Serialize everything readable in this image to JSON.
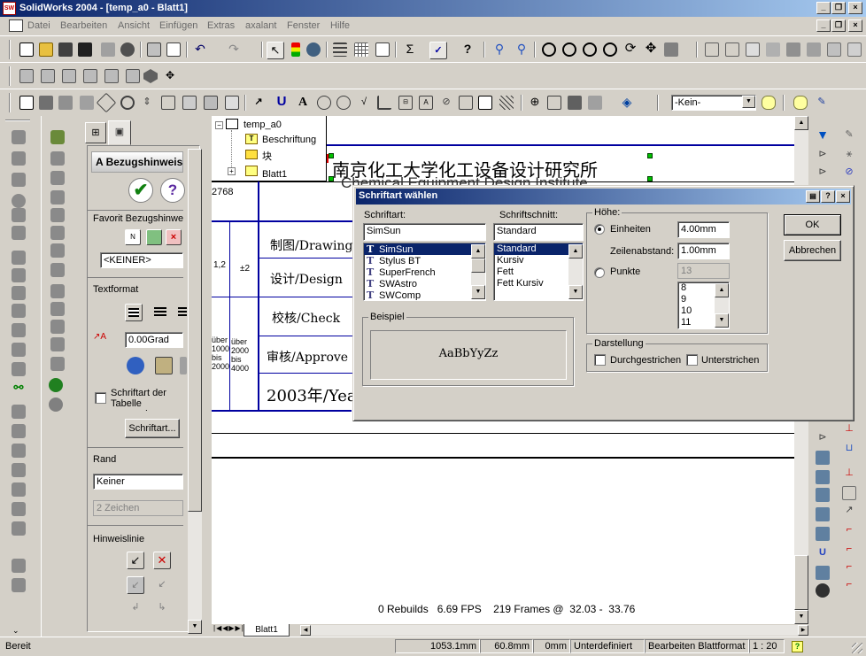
{
  "window": {
    "title": "SolidWorks 2004 - [temp_a0 - Blatt1]",
    "app_icon": "SW"
  },
  "menu": [
    "Datei",
    "Bearbeiten",
    "Ansicht",
    "Einfügen",
    "Extras",
    "axalant",
    "Fenster",
    "Hilfe"
  ],
  "toolbar": {
    "layer_value": "-Kein-"
  },
  "manager": {
    "header": "Bezugshinweis",
    "favorit_label": "Favorit Bezugshinweis",
    "favorit_value": "<KEINER>",
    "textformat_label": "Textformat",
    "angle_value": "0.00Grad",
    "use_table_font_label": "Schriftart der Tabelle verwenden",
    "font_button": "Schriftart...",
    "rand_label": "Rand",
    "rand_value": "Keiner",
    "rand_size": "2 Zeichen",
    "leader_label": "Hinweislinie"
  },
  "tree": {
    "root": "temp_a0",
    "items": [
      "Beschriftung",
      "块",
      "Blatt1"
    ]
  },
  "drawing": {
    "institute_cn": "南京化工大学化工设备设计研究所",
    "institute_en_partial": "Chemical Equipment Design Institute",
    "num": "2768",
    "rows": [
      "制图/Drawing",
      "设计/Design",
      "校核/Check",
      "审核/Approve",
      "2003年/Year"
    ],
    "tol_cols": [
      "1,2",
      "±2"
    ],
    "tol_small": [
      "über 1000 bis 2000",
      "über 2000 bis 4000"
    ]
  },
  "dialog": {
    "title": "Schriftart wählen",
    "font_label": "Schriftart:",
    "font_value": "SimSun",
    "fonts": [
      "SimSun",
      "Stylus BT",
      "SuperFrench",
      "SWAstro",
      "SWComp"
    ],
    "style_label": "Schriftschnitt:",
    "style_value": "Standard",
    "styles": [
      "Standard",
      "Kursiv",
      "Fett",
      "Fett Kursiv"
    ],
    "height_label": "Höhe:",
    "units_label": "Einheiten",
    "units_value": "4.00mm",
    "spacing_label": "Zeilenabstand:",
    "spacing_value": "1.00mm",
    "points_label": "Punkte",
    "points_value": "13",
    "points_list": [
      "8",
      "9",
      "10",
      "11"
    ],
    "example_label": "Beispiel",
    "example_text": "AaBbYyZz",
    "display_label": "Darstellung",
    "strike_label": "Durchgestrichen",
    "underline_label": "Unterstrichen",
    "ok": "OK",
    "cancel": "Abbrechen"
  },
  "canvas": {
    "fps_text": "0 Rebuilds   6.69 FPS    219 Frames @  32.03 -  33.76",
    "sheet_tab": "Blatt1"
  },
  "status": {
    "ready": "Bereit",
    "x": "1053.1mm",
    "y": "60.8mm",
    "z": "0mm",
    "state": "Unterdefiniert",
    "mode": "Bearbeiten Blattformat",
    "scale": "1 : 20",
    "help": "?"
  }
}
